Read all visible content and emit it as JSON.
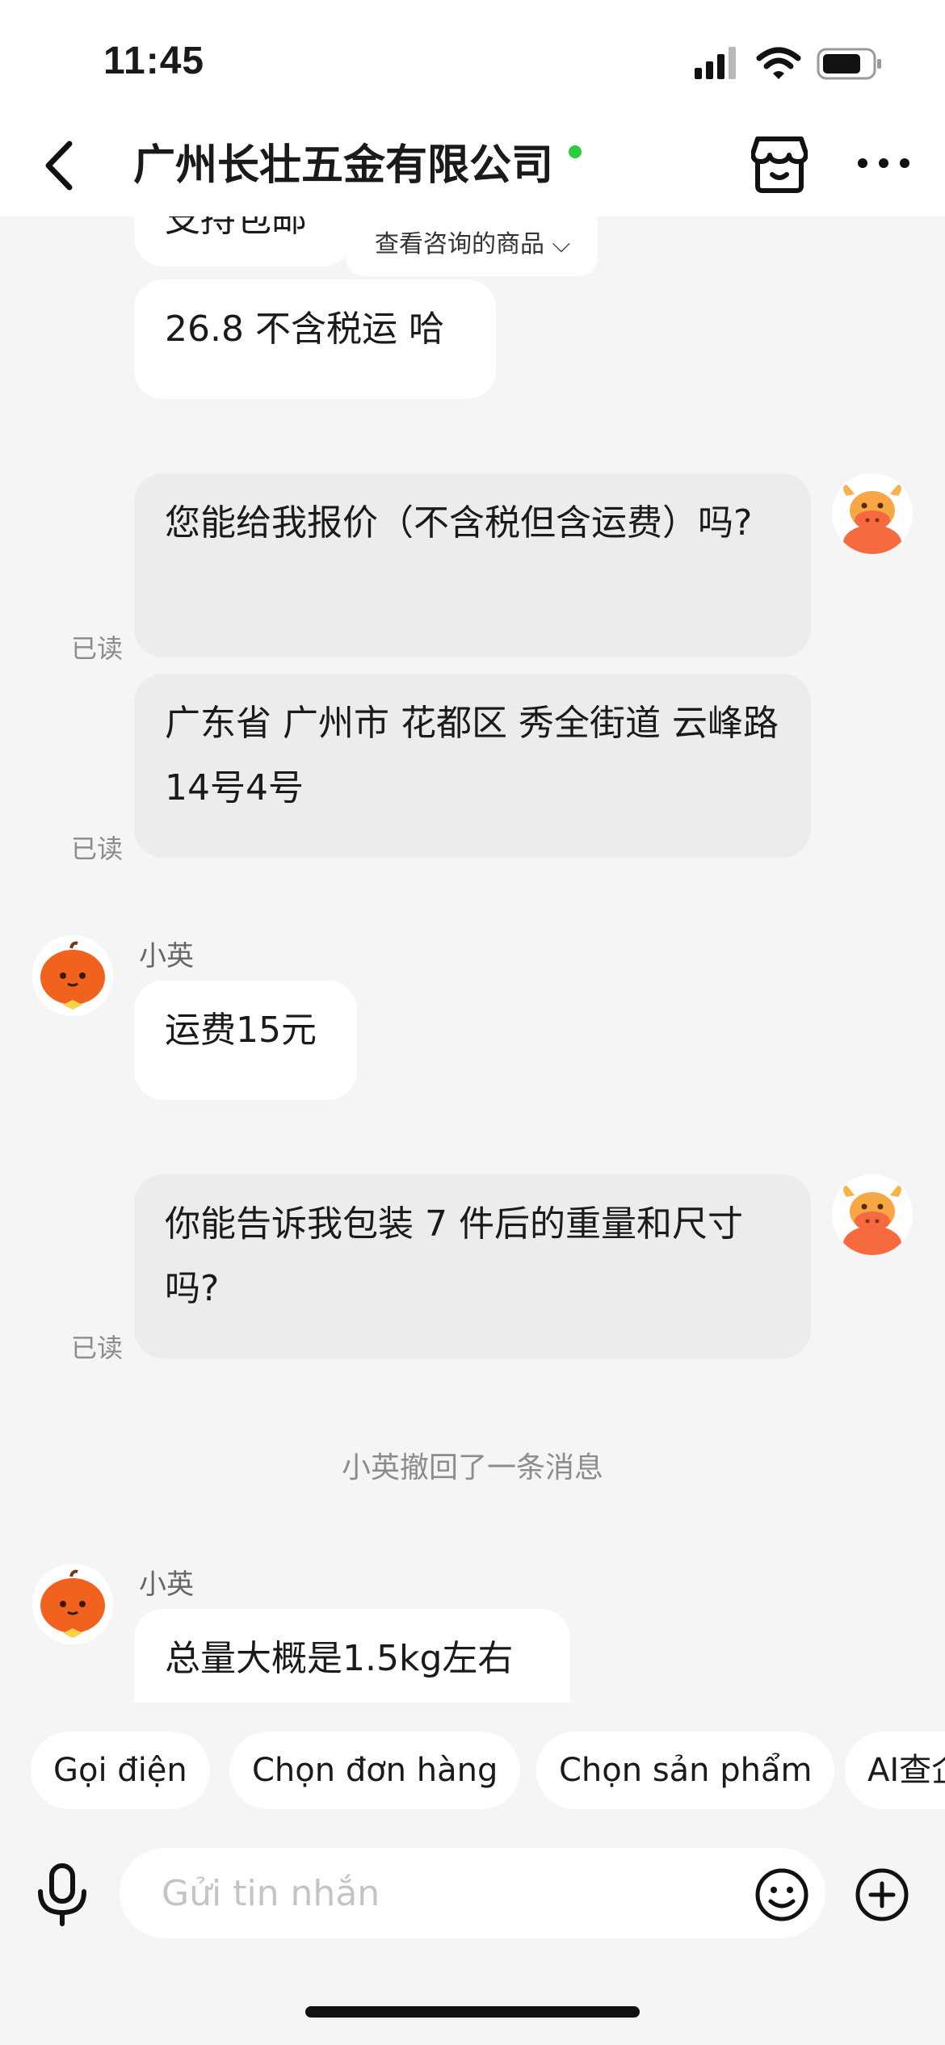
{
  "status": {
    "time": "11:45"
  },
  "header": {
    "title": "广州长壮五金有限公司",
    "online_color": "#2ecc40"
  },
  "chat": {
    "product_link": "查看咨询的商品 ⌵",
    "partial_text": "支持包邮",
    "messages": [
      {
        "text": "26.8 不含税运 哈"
      },
      {
        "text": "您能给我报价（不含税但含运费）吗?",
        "read": "已读"
      },
      {
        "text": "广东省 广州市 花都区 秀全街道 云峰路14号4号",
        "read": "已读"
      },
      {
        "sender": "小英",
        "text": "运费15元"
      },
      {
        "text": "你能告诉我包装 7 件后的重量和尺寸吗?",
        "read": "已读"
      },
      {
        "system": "小英撤回了一条消息"
      },
      {
        "sender": "小英",
        "text": "总量大概是1.5kg左右"
      }
    ]
  },
  "quick_actions": [
    "Gọi điện",
    "Chọn đơn hàng",
    "Chọn sản phẩm",
    "AI查企"
  ],
  "input": {
    "placeholder": "Gửi tin nhắn"
  }
}
